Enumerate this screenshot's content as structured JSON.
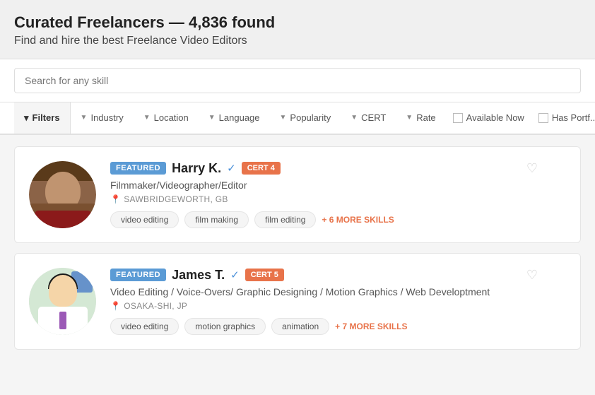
{
  "header": {
    "title": "Curated Freelancers — 4,836 found",
    "subtitle": "Find and hire the best Freelance Video Editors"
  },
  "search": {
    "placeholder": "Search for any skill"
  },
  "filters": {
    "main_label": "Filters",
    "items": [
      {
        "label": "Industry"
      },
      {
        "label": "Location"
      },
      {
        "label": "Language"
      },
      {
        "label": "Popularity"
      },
      {
        "label": "CERT"
      },
      {
        "label": "Rate"
      }
    ],
    "checkboxes": [
      {
        "label": "Available Now"
      },
      {
        "label": "Has Portf..."
      }
    ]
  },
  "freelancers": [
    {
      "featured_label": "FEATURED",
      "name": "Harry K.",
      "title": "Filmmaker/Videographer/Editor",
      "location": "SAWBRIDGEWORTH, GB",
      "cert": "CERT 4",
      "skills": [
        "video editing",
        "film making",
        "film editing"
      ],
      "more_skills": "+ 6 MORE SKILLS"
    },
    {
      "featured_label": "FEATURED",
      "name": "James T.",
      "title": "Video Editing / Voice-Overs/ Graphic Designing / Motion Graphics / Web Developtment",
      "location": "OSAKA-SHI, JP",
      "cert": "CERT 5",
      "skills": [
        "video editing",
        "motion graphics",
        "animation"
      ],
      "more_skills": "+ 7 MORE SKILLS"
    }
  ]
}
